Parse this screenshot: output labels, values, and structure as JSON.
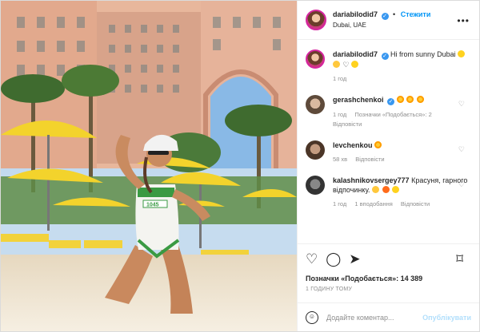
{
  "post": {
    "username": "dariabilodid7",
    "follow_label": "Стежити",
    "location": "Dubai, UAE",
    "more_icon": "more-horizontal-icon"
  },
  "caption": {
    "username": "dariabilodid7",
    "text": "Hi from sunny Dubai",
    "time": "1 год"
  },
  "comments": [
    {
      "username": "gerashchenkoi",
      "time": "1 год",
      "likes": "Позначки «Подобається»: 2",
      "reply": "Відповісти"
    },
    {
      "username": "levchenkou",
      "time": "58 хв",
      "reply": "Відповісти"
    },
    {
      "username": "kalashnikovsergey777",
      "text": "Красуня, гарного відпочинку.",
      "time": "1 год",
      "likes": "1 вподобання",
      "reply": "Відповісти"
    }
  ],
  "actions": {
    "likes_text": "Позначки «Подобається»: 14 389",
    "timestamp": "1 ГОДИНУ ТОМУ"
  },
  "comment_box": {
    "placeholder": "Додайте коментар...",
    "publish_label": "Опублікувати"
  },
  "photo": {
    "bikini_text": "1045"
  },
  "colors": {
    "accent": "#0095f6",
    "verified": "#3897f0",
    "umbrella": "#f3d32c",
    "hotel": "#e9b59a"
  }
}
